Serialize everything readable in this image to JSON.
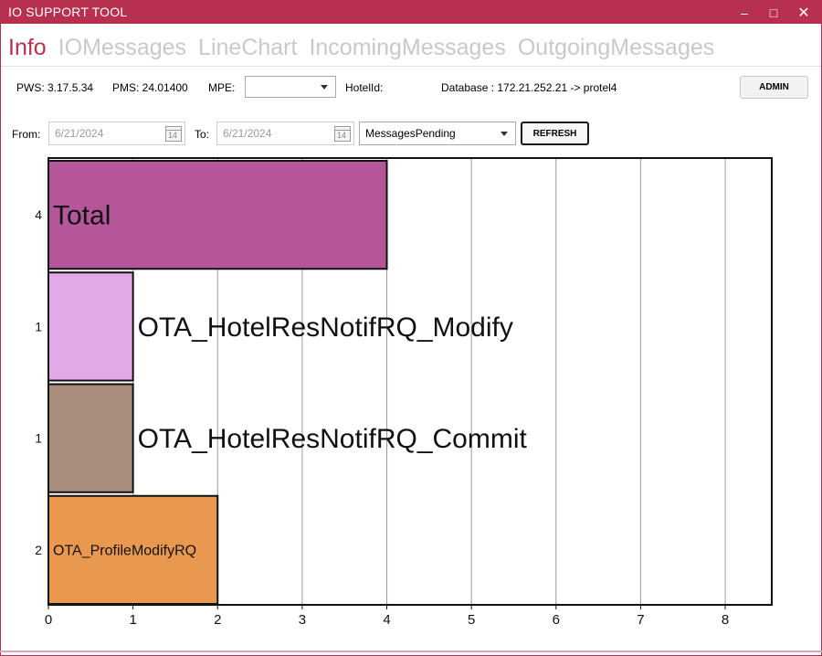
{
  "window": {
    "title": "IO SUPPORT TOOL",
    "min_glyph": "–",
    "max_glyph": "□",
    "close_glyph": "✕"
  },
  "tabs": [
    {
      "label": "Info",
      "active": true
    },
    {
      "label": "IOMessages",
      "active": false
    },
    {
      "label": "LineChart",
      "active": false
    },
    {
      "label": "IncomingMessages",
      "active": false
    },
    {
      "label": "OutgoingMessages",
      "active": false
    }
  ],
  "info": {
    "pws": "PWS: 3.17.5.34",
    "pms": "PMS: 24.01400",
    "mpe_label": "MPE:",
    "mpe_value": "",
    "hotel_label": "HotelId:",
    "database": "Database : 172.21.252.21 -> protel4",
    "admin_label": "ADMIN"
  },
  "filters": {
    "from_label": "From:",
    "from_value": "6/21/2024",
    "to_label": "To:",
    "to_value": "6/21/2024",
    "calendar_day": "14",
    "select_value": "MessagesPending",
    "refresh_label": "REFRESH"
  },
  "chart_data": {
    "type": "bar",
    "orientation": "horizontal",
    "categories": [
      "Total",
      "OTA_HotelResNotifRQ_Modify",
      "OTA_HotelResNotifRQ_Commit",
      "OTA_ProfileModifyRQ"
    ],
    "values": [
      4,
      1,
      1,
      2
    ],
    "colors": [
      "#b5559a",
      "#e2a9e9",
      "#a88d7d",
      "#e8994f"
    ],
    "xlim": [
      0,
      8.55
    ],
    "xticks": [
      0,
      1,
      2,
      3,
      4,
      5,
      6,
      7,
      8
    ],
    "grid": true,
    "title": "",
    "xlabel": "",
    "ylabel": ""
  }
}
